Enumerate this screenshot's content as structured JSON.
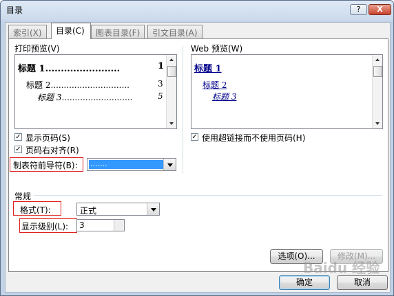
{
  "window": {
    "title": "目录",
    "help_label": "?",
    "close_label": "X"
  },
  "tabs": [
    {
      "label": "索引(X)"
    },
    {
      "label": "目录(C)"
    },
    {
      "label": "图表目录(F)"
    },
    {
      "label": "引文目录(A)"
    }
  ],
  "print_preview": {
    "label": "打印预览(V)",
    "entries": [
      {
        "text": "标题 1",
        "leader": "........................",
        "page": "1"
      },
      {
        "text": "标题 2",
        "leader": "..............................",
        "page": "3"
      },
      {
        "text": "标题 3",
        "leader": "...........................",
        "page": "5"
      }
    ]
  },
  "web_preview": {
    "label": "Web 预览(W)",
    "entries": [
      "标题 1",
      "标题 2",
      "标题 3"
    ]
  },
  "options": {
    "show_page_numbers": {
      "label": "显示页码(S)",
      "checked": true
    },
    "right_align": {
      "label": "页码右对齐(R)",
      "checked": true
    },
    "use_hyperlinks": {
      "label": "使用超链接而不使用页码(H)",
      "checked": true
    },
    "tab_leader": {
      "label": "制表符前导符(B):",
      "value": "......."
    }
  },
  "general": {
    "label": "常规",
    "format": {
      "label": "格式(T):",
      "value": "正式"
    },
    "levels": {
      "label": "显示级别(L):",
      "value": "3"
    }
  },
  "buttons": {
    "options": "选项(O)...",
    "modify": "修改(M)...",
    "ok": "确定",
    "cancel": "取消"
  },
  "watermark": "Baidu 经验"
}
